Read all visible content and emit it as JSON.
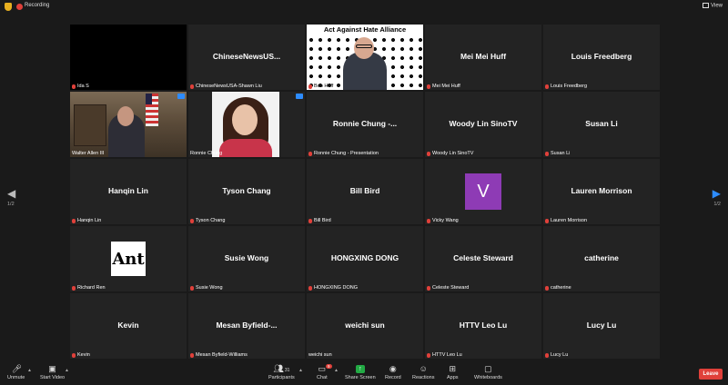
{
  "topbar": {
    "recording": "Recording",
    "view": "View"
  },
  "paging": {
    "left": "1/2",
    "right": "1/2"
  },
  "tiles": [
    {
      "name": "",
      "label": "Ida S"
    },
    {
      "name": "ChineseNewsUS...",
      "label": "ChineseNewsUSA-Shawn Liu"
    },
    {
      "name": "",
      "label": "Bob Huff",
      "banner": "Act Against Hate Alliance"
    },
    {
      "name": "Mei Mei Huff",
      "label": "Mei Mei Huff"
    },
    {
      "name": "Louis Freedberg",
      "label": "Louis Freedberg"
    },
    {
      "name": "",
      "label": "Walter Allen III"
    },
    {
      "name": "",
      "label": "Ronnie Chung"
    },
    {
      "name": "Ronnie  Chung  -...",
      "label": "Ronnie Chung - Presentation"
    },
    {
      "name": "Woody Lin SinoTV",
      "label": "Woody Lin SinoTV"
    },
    {
      "name": "Susan Li",
      "label": "Susan Li"
    },
    {
      "name": "Hanqin Lin",
      "label": "Hanqin Lin"
    },
    {
      "name": "Tyson Chang",
      "label": "Tyson Chang"
    },
    {
      "name": "Bill Bird",
      "label": "Bill Bird"
    },
    {
      "name": "",
      "label": "Vicky Wang",
      "avatar": "V"
    },
    {
      "name": "Lauren Morrison",
      "label": "Lauren Morrison"
    },
    {
      "name": "",
      "label": "Richard Ren",
      "logo": "Ant"
    },
    {
      "name": "Susie Wong",
      "label": "Susie Wong"
    },
    {
      "name": "HONGXING DONG",
      "label": "HONGXING DONG"
    },
    {
      "name": "Celeste Steward",
      "label": "Celeste Steward"
    },
    {
      "name": "catherine",
      "label": "catherine"
    },
    {
      "name": "Kevin",
      "label": "Kevin"
    },
    {
      "name": "Mesan  Byfield-...",
      "label": "Mesan Byfield-Williams"
    },
    {
      "name": "weichi sun",
      "label": "weichi sun"
    },
    {
      "name": "HTTV Leo Lu",
      "label": "HTTV Leo Lu"
    },
    {
      "name": "Lucy Lu",
      "label": "Lucy Lu"
    }
  ],
  "toolbar": {
    "unmute": "Unmute",
    "start_video": "Start Video",
    "participants": "Participants",
    "participants_count": "31",
    "chat": "Chat",
    "chat_badge": "9",
    "share_screen": "Share Screen",
    "record": "Record",
    "reactions": "Reactions",
    "apps": "Apps",
    "whiteboards": "Whiteboards",
    "leave": "Leave"
  },
  "colors": {
    "accent": "#2d8cff",
    "leave": "#e0403a",
    "share": "#22aa44",
    "active_speaker": "#e8d840",
    "avatar_v": "#8e3bb5"
  }
}
